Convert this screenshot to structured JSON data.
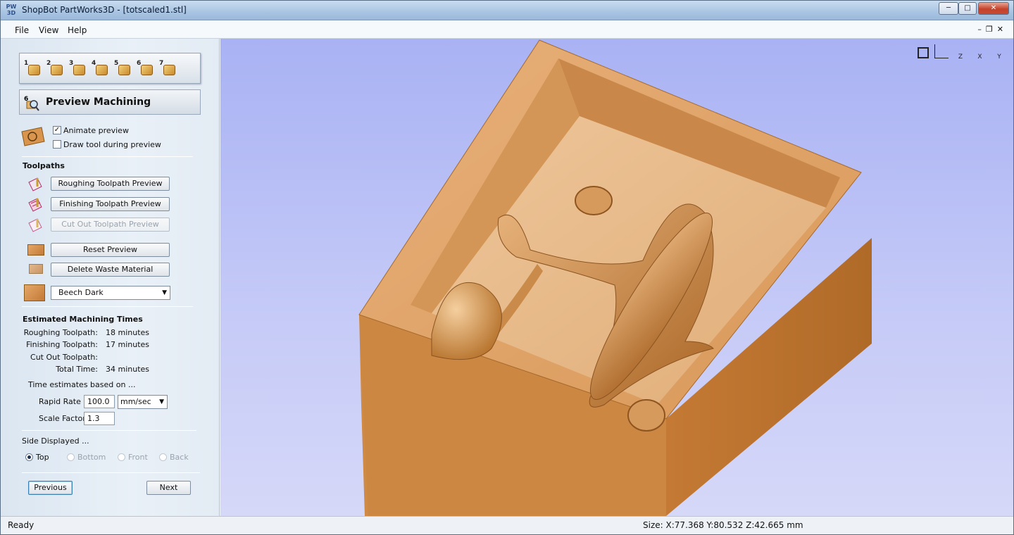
{
  "window": {
    "title": "ShopBot PartWorks3D - [totscaled1.stl]",
    "logo_top": "PW",
    "logo_bottom": "3D"
  },
  "menu": [
    "File",
    "View",
    "Help"
  ],
  "steps": [
    "1",
    "2",
    "3",
    "4",
    "5",
    "6",
    "7"
  ],
  "panel": {
    "title": "Preview Machining",
    "animate_preview": "Animate preview",
    "draw_tool": "Draw tool during preview",
    "toolpaths_header": "Toolpaths",
    "roughing_button": "Roughing Toolpath Preview",
    "finishing_button": "Finishing Toolpath Preview",
    "cutout_button": "Cut Out Toolpath Preview",
    "reset_button": "Reset Preview",
    "delete_button": "Delete Waste Material",
    "material": "Beech Dark",
    "times_header": "Estimated Machining Times",
    "times": [
      {
        "label": "Roughing Toolpath:",
        "value": "18 minutes"
      },
      {
        "label": "Finishing Toolpath:",
        "value": "17 minutes"
      },
      {
        "label": "Cut Out Toolpath:",
        "value": ""
      },
      {
        "label": "Total Time:",
        "value": "34 minutes"
      }
    ],
    "time_note": "Time estimates based on ...",
    "rapid_rate_label": "Rapid Rate",
    "rapid_rate_value": "100.0",
    "rapid_rate_unit": "mm/sec",
    "scale_factor_label": "Scale Factor",
    "scale_factor_value": "1.3",
    "side_header": "Side Displayed ...",
    "sides": [
      "Top",
      "Bottom",
      "Front",
      "Back"
    ],
    "selected_side": "Top",
    "previous_button": "Previous",
    "next_button": "Next"
  },
  "view_icons": [
    "zoom-extents-icon",
    "iso-view-icon",
    "z-view-icon",
    "x-view-icon",
    "y-view-icon"
  ],
  "view_icon_labels": [
    "",
    "",
    "Z",
    "X",
    "Y"
  ],
  "status": {
    "left": "Ready",
    "right": "Size: X:77.368 Y:80.532 Z:42.665 mm"
  }
}
